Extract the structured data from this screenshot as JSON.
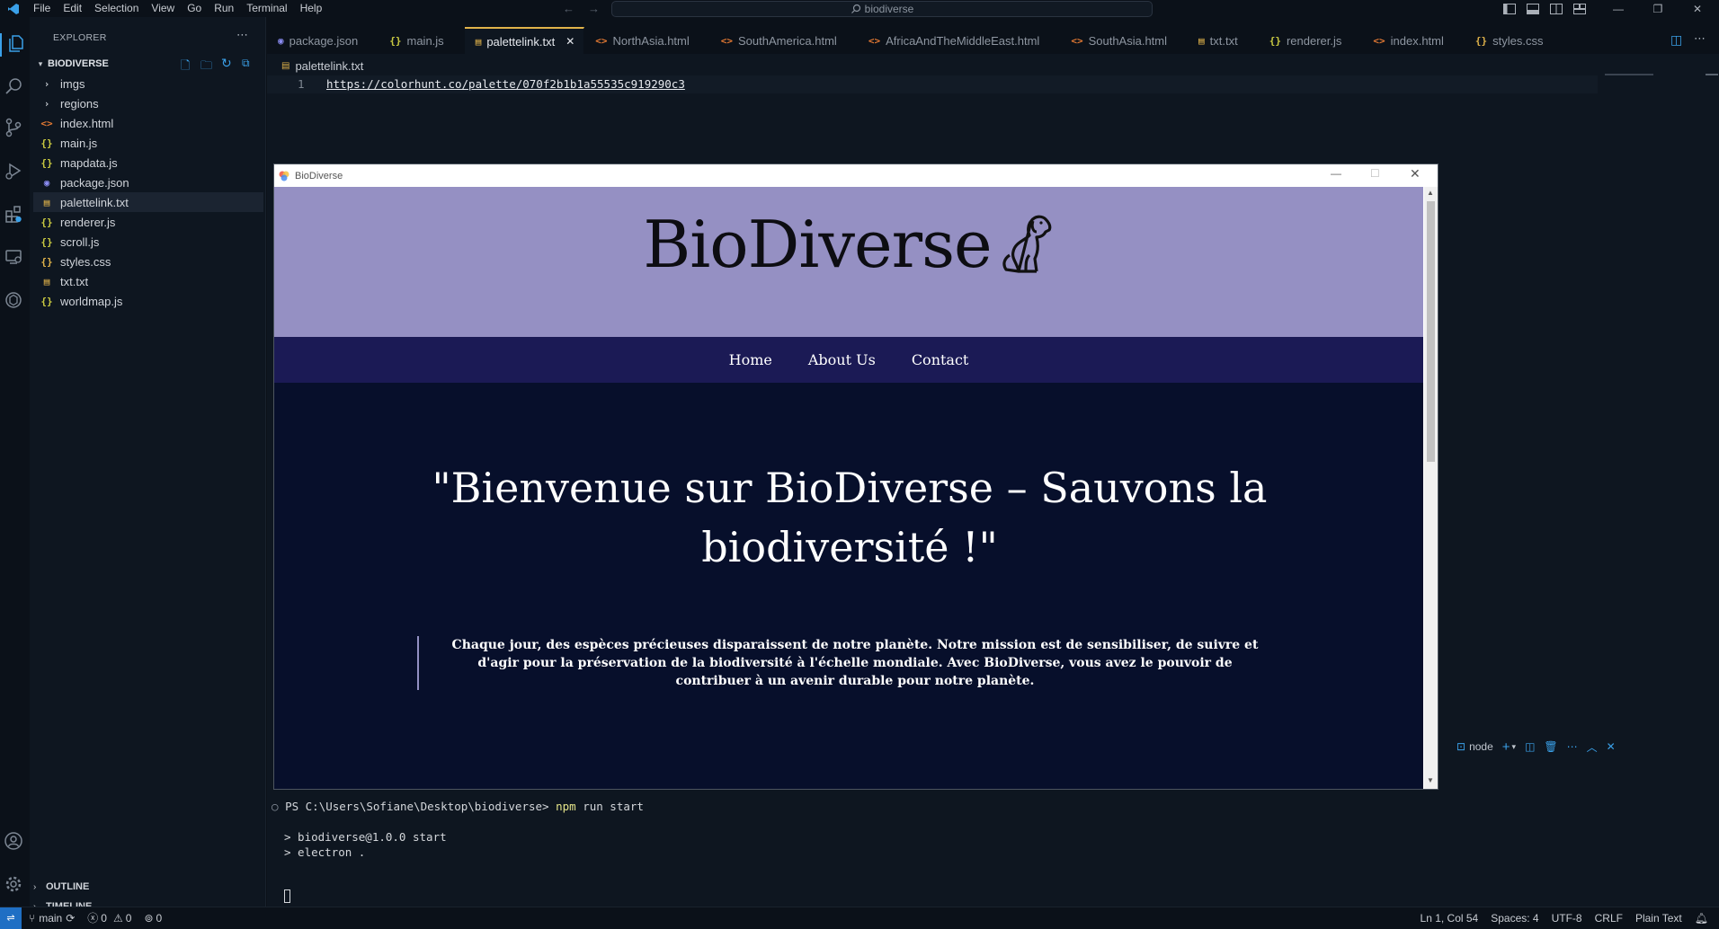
{
  "titlebar": {
    "menu": [
      "File",
      "Edit",
      "Selection",
      "View",
      "Go",
      "Run",
      "Terminal",
      "Help"
    ],
    "search": "biodiverse"
  },
  "explorer": {
    "header": "EXPLORER",
    "root": "BIODIVERSE",
    "items": [
      {
        "label": "imgs",
        "icon": "chevron-right",
        "color": "#c5cad0"
      },
      {
        "label": "regions",
        "icon": "chevron-right",
        "color": "#c5cad0"
      },
      {
        "label": "index.html",
        "icon": "<>",
        "color": "#e37933"
      },
      {
        "label": "main.js",
        "icon": "{}",
        "color": "#cbcb41"
      },
      {
        "label": "mapdata.js",
        "icon": "{}",
        "color": "#cbcb41"
      },
      {
        "label": "package.json",
        "icon": "npm",
        "color": "#8b8cf2"
      },
      {
        "label": "palettelink.txt",
        "icon": "txt",
        "color": "#e0b34a"
      },
      {
        "label": "renderer.js",
        "icon": "{}",
        "color": "#cbcb41"
      },
      {
        "label": "scroll.js",
        "icon": "{}",
        "color": "#cbcb41"
      },
      {
        "label": "styles.css",
        "icon": "{}",
        "color": "#e0b34a"
      },
      {
        "label": "txt.txt",
        "icon": "txt",
        "color": "#e0b34a"
      },
      {
        "label": "worldmap.js",
        "icon": "{}",
        "color": "#cbcb41"
      }
    ],
    "outline": "OUTLINE",
    "timeline": "TIMELINE"
  },
  "tabs": [
    {
      "label": "package.json",
      "icon": "npm",
      "color": "#8b8cf2"
    },
    {
      "label": "main.js",
      "icon": "{}",
      "color": "#cbcb41"
    },
    {
      "label": "palettelink.txt",
      "icon": "txt",
      "color": "#e0b34a",
      "active": true
    },
    {
      "label": "NorthAsia.html",
      "icon": "<>",
      "color": "#e37933"
    },
    {
      "label": "SouthAmerica.html",
      "icon": "<>",
      "color": "#e37933"
    },
    {
      "label": "AfricaAndTheMiddleEast.html",
      "icon": "<>",
      "color": "#e37933"
    },
    {
      "label": "SouthAsia.html",
      "icon": "<>",
      "color": "#e37933"
    },
    {
      "label": "txt.txt",
      "icon": "txt",
      "color": "#e0b34a"
    },
    {
      "label": "renderer.js",
      "icon": "{}",
      "color": "#cbcb41"
    },
    {
      "label": "index.html",
      "icon": "<>",
      "color": "#e37933"
    },
    {
      "label": "styles.css",
      "icon": "{}",
      "color": "#e0b34a"
    }
  ],
  "editor": {
    "breadcrumb": "palettelink.txt",
    "line_number": "1",
    "line_text": "https://colorhunt.co/palette/070f2b1b1a55535c919290c3"
  },
  "app": {
    "window_title": "BioDiverse",
    "brand": "BioDiverse",
    "nav": [
      "Home",
      "About Us",
      "Contact"
    ],
    "headline": "\"Bienvenue sur BioDiverse – Sauvons la biodiversité !\"",
    "paragraph": "Chaque jour, des espèces précieuses disparaissent de notre planète. Notre mission est de sensibiliser, de suivre et d'agir pour la préservation de la biodiversité à l'échelle mondiale. Avec BioDiverse, vous avez le pouvoir de contribuer à un avenir durable pour notre planète.",
    "colors": {
      "header": "#9290c3",
      "nav": "#1b1a55",
      "main": "#070f2b"
    }
  },
  "terminal": {
    "shell_label": "node",
    "prompt": "PS C:\\Users\\Sofiane\\Desktop\\biodiverse> ",
    "cmd_npm": "npm",
    "cmd_rest": " run start",
    "out1": "> biodiverse@1.0.0 start",
    "out2": "> electron ."
  },
  "status": {
    "branch": "main",
    "errors": "0",
    "warnings": "0",
    "ports": "0",
    "position": "Ln 1, Col 54",
    "spaces": "Spaces: 4",
    "encoding": "UTF-8",
    "eol": "CRLF",
    "language": "Plain Text"
  }
}
